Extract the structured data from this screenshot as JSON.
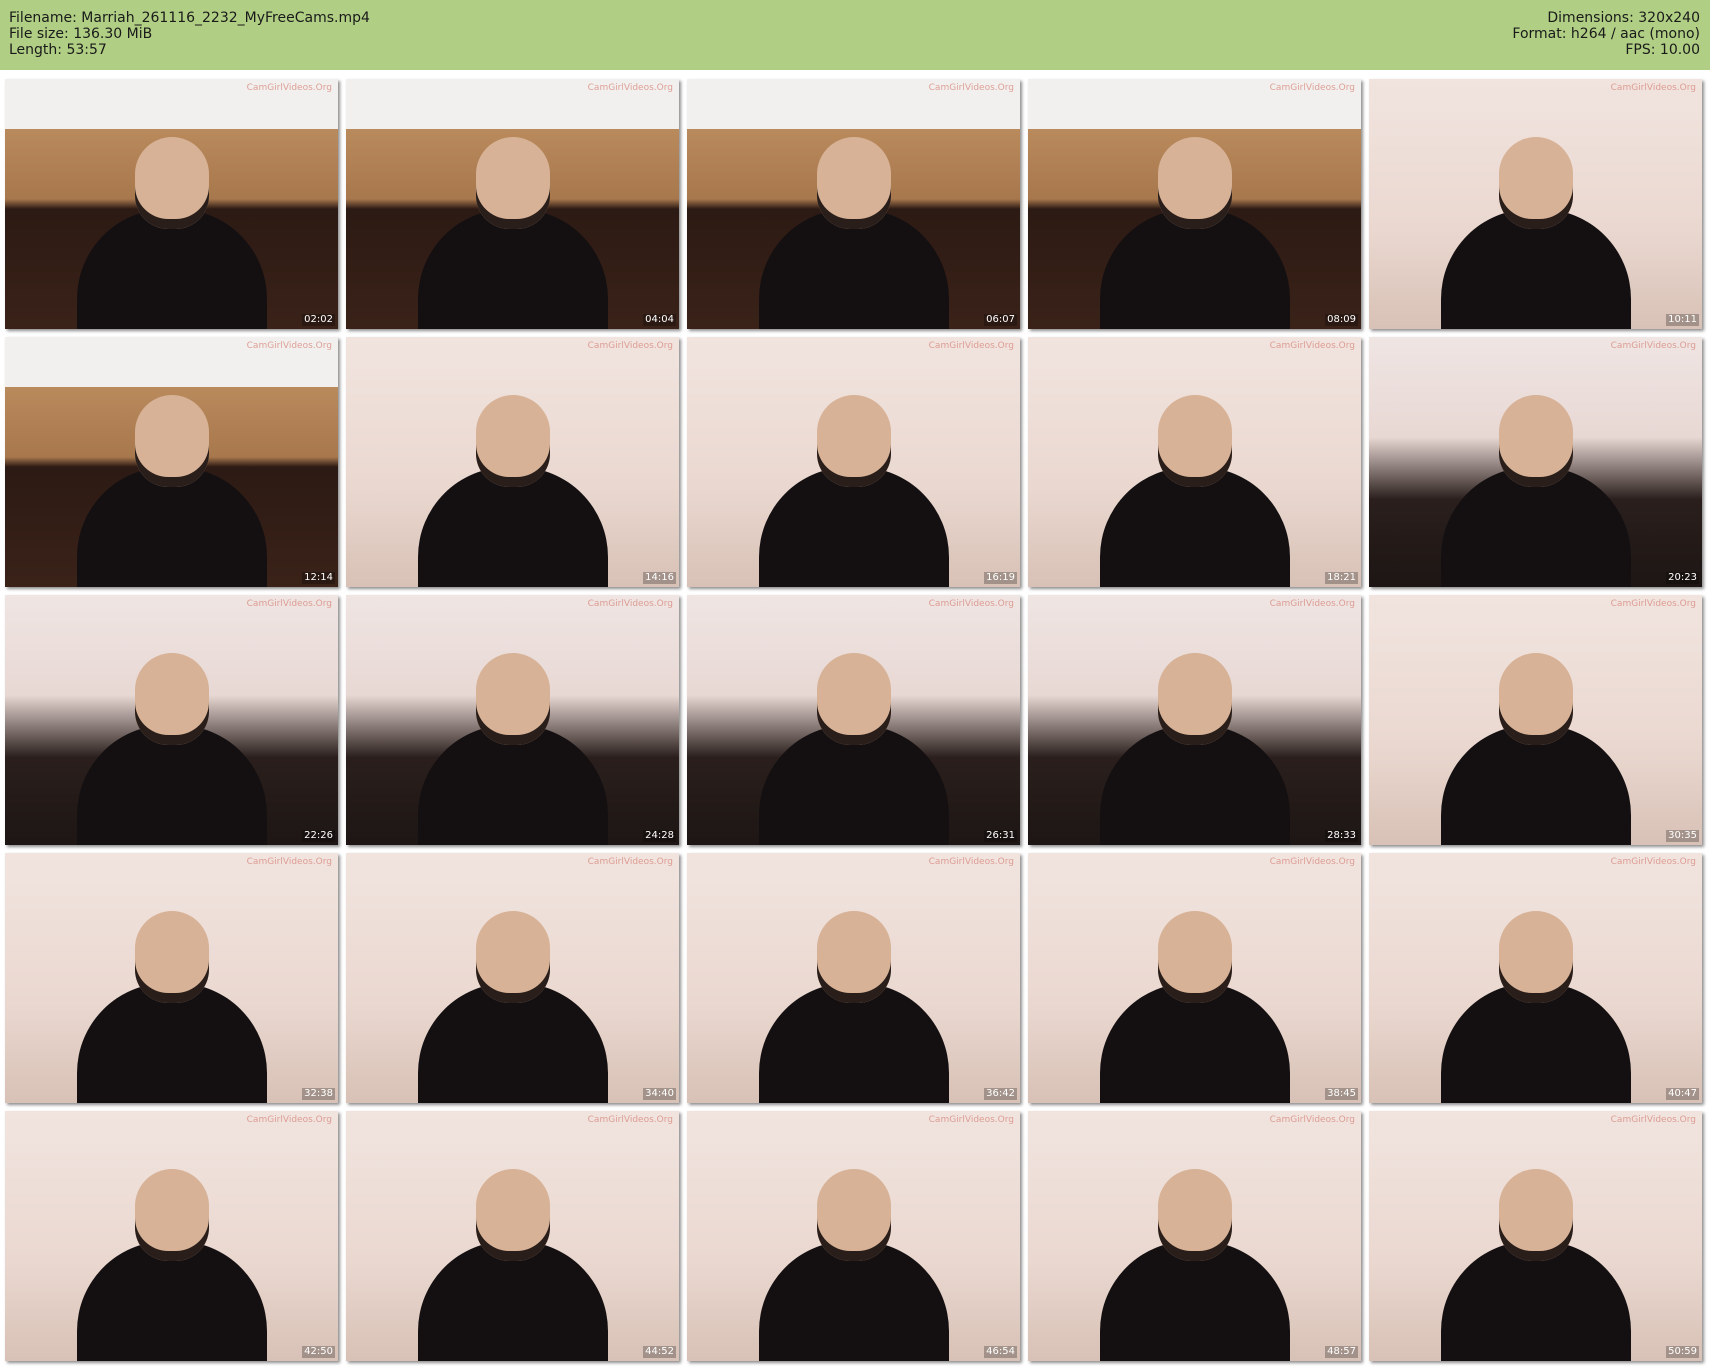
{
  "header": {
    "filename_label": "Filename: Marriah_261116_2232_MyFreeCams.mp4",
    "filesize_label": "File size: 136.30 MiB",
    "length_label": "Length: 53:57",
    "dimensions_label": "Dimensions: 320x240",
    "format_label": "Format: h264 / aac (mono)",
    "fps_label": "FPS: 10.00",
    "background_color": "#b0cf84"
  },
  "watermark": "CamGirlVideos.Org",
  "thumbnails": [
    {
      "timestamp": "02:02",
      "scene": "kitchen"
    },
    {
      "timestamp": "04:04",
      "scene": "kitchen"
    },
    {
      "timestamp": "06:07",
      "scene": "kitchen"
    },
    {
      "timestamp": "08:09",
      "scene": "kitchen"
    },
    {
      "timestamp": "10:11",
      "scene": "wall"
    },
    {
      "timestamp": "12:14",
      "scene": "kitchen"
    },
    {
      "timestamp": "14:16",
      "scene": "wall"
    },
    {
      "timestamp": "16:19",
      "scene": "wall"
    },
    {
      "timestamp": "18:21",
      "scene": "wall"
    },
    {
      "timestamp": "20:23",
      "scene": "sofa"
    },
    {
      "timestamp": "22:26",
      "scene": "sofa"
    },
    {
      "timestamp": "24:28",
      "scene": "sofa"
    },
    {
      "timestamp": "26:31",
      "scene": "sofa"
    },
    {
      "timestamp": "28:33",
      "scene": "sofa"
    },
    {
      "timestamp": "30:35",
      "scene": "wall"
    },
    {
      "timestamp": "32:38",
      "scene": "wall"
    },
    {
      "timestamp": "34:40",
      "scene": "wall"
    },
    {
      "timestamp": "36:42",
      "scene": "wall"
    },
    {
      "timestamp": "38:45",
      "scene": "wall"
    },
    {
      "timestamp": "40:47",
      "scene": "wall"
    },
    {
      "timestamp": "42:50",
      "scene": "wall"
    },
    {
      "timestamp": "44:52",
      "scene": "wall"
    },
    {
      "timestamp": "46:54",
      "scene": "wall"
    },
    {
      "timestamp": "48:57",
      "scene": "wall"
    },
    {
      "timestamp": "50:59",
      "scene": "wall"
    }
  ]
}
